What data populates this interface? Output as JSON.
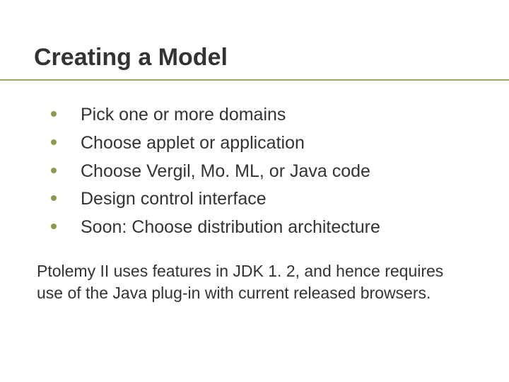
{
  "title": "Creating a Model",
  "bullets": [
    "Pick one or more domains",
    "Choose applet or application",
    "Choose Vergil, Mo. ML, or Java code",
    "Design control interface",
    "Soon: Choose distribution architecture"
  ],
  "note": "Ptolemy II uses features in JDK 1. 2, and hence requires use of the Java plug-in with current released browsers."
}
